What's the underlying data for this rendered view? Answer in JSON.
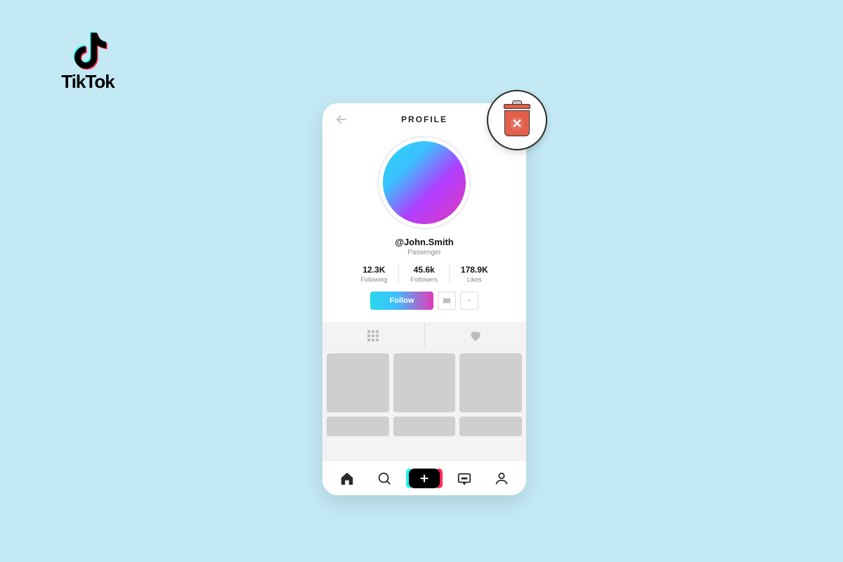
{
  "brand": {
    "name": "TikTok"
  },
  "header": {
    "title": "PROFILE"
  },
  "profile": {
    "username": "@John.Smith",
    "subtitle": "Passenger"
  },
  "stats": {
    "following": {
      "value": "12.3K",
      "label": "Following"
    },
    "followers": {
      "value": "45.6k",
      "label": "Followers"
    },
    "likes": {
      "value": "178.9K",
      "label": "Likes"
    }
  },
  "actions": {
    "follow_label": "Follow"
  }
}
